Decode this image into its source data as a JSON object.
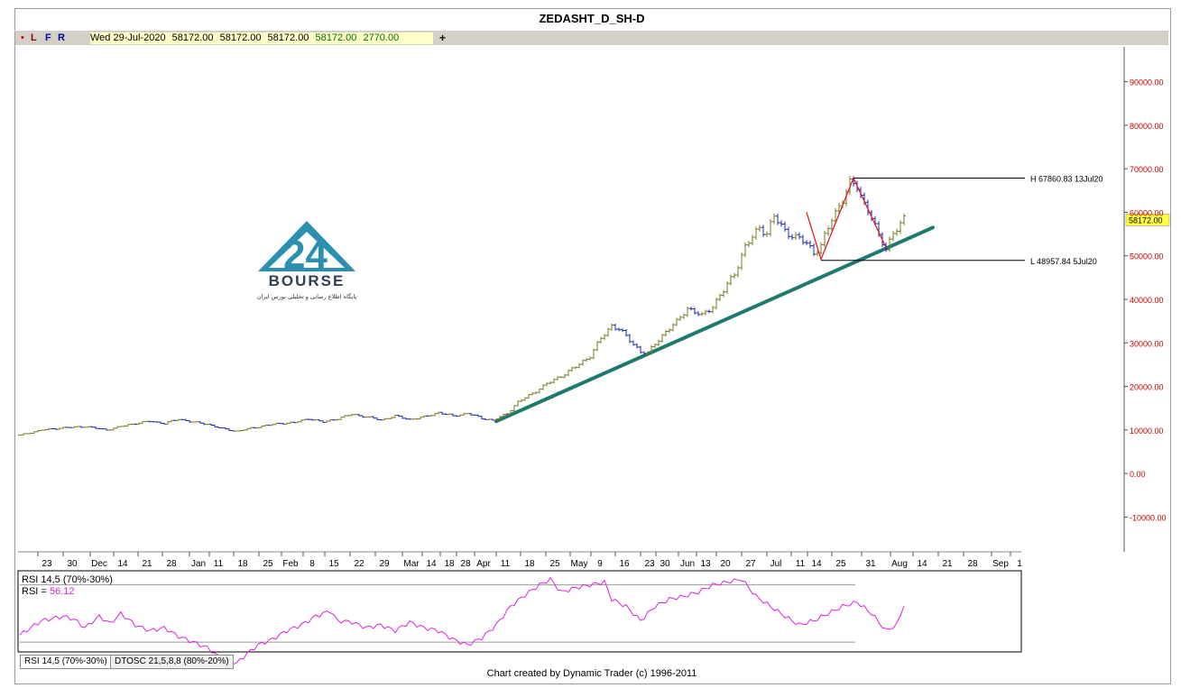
{
  "window": {
    "title": "ZEDASHT_D_SH-D"
  },
  "infobar": {
    "dot": "•",
    "letters": [
      "L",
      "F",
      "R"
    ],
    "date": "Wed 29-Jul-2020",
    "open": "58172.00",
    "high": "58172.00",
    "low": "58172.00",
    "close": "58172.00",
    "volume": "2770.00",
    "plus": "+"
  },
  "logo": {
    "brand": "BOURSE",
    "tagline": "پایگاه اطلاع رسانی و تحلیلی بورس ایران"
  },
  "annotations": {
    "high_label": "H 67860.83 13Jul20",
    "low_label": "L 48957.84 5Jul20",
    "last_price": "58172.00"
  },
  "chart_data": [
    {
      "type": "bar",
      "title": "ZEDASHT_D_SH-D",
      "ylim": [
        -18000,
        98000
      ],
      "yticks": [
        "90000.00",
        "80000.00",
        "70000.00",
        "60000.00",
        "50000.00",
        "40000.00",
        "30000.00",
        "20000.00",
        "10000.00",
        "0.00",
        "-10000.00"
      ],
      "ytick_values": [
        90000,
        80000,
        70000,
        60000,
        50000,
        40000,
        30000,
        20000,
        10000,
        0,
        -10000
      ],
      "xtick_labels": [
        "23",
        "30",
        "Dec",
        "14",
        "21",
        "28",
        "Jan",
        "11",
        "18",
        "25",
        "Feb",
        "8",
        "15",
        "22",
        "29",
        "Mar",
        "14",
        "18",
        "28",
        "Apr",
        "11",
        "18",
        "25",
        "May",
        "9",
        "16",
        "23",
        "30",
        "Jun",
        "13",
        "20",
        "27",
        "Jul",
        "11",
        "14",
        "25",
        "31",
        "Aug",
        "14",
        "21",
        "28",
        "Sep",
        "1"
      ],
      "price_anchors": [
        [
          0,
          8800
        ],
        [
          6,
          10000
        ],
        [
          12,
          10500
        ],
        [
          18,
          10800
        ],
        [
          24,
          10000
        ],
        [
          30,
          11200
        ],
        [
          36,
          12000
        ],
        [
          40,
          11500
        ],
        [
          44,
          12500
        ],
        [
          48,
          11800
        ],
        [
          52,
          11300
        ],
        [
          56,
          10300
        ],
        [
          60,
          9700
        ],
        [
          64,
          10400
        ],
        [
          68,
          11000
        ],
        [
          72,
          11500
        ],
        [
          76,
          11700
        ],
        [
          80,
          12600
        ],
        [
          84,
          11800
        ],
        [
          88,
          12600
        ],
        [
          92,
          13600
        ],
        [
          96,
          13000
        ],
        [
          100,
          12300
        ],
        [
          104,
          13200
        ],
        [
          108,
          12400
        ],
        [
          112,
          13000
        ],
        [
          116,
          14000
        ],
        [
          120,
          13200
        ],
        [
          124,
          13800
        ],
        [
          128,
          12700
        ],
        [
          131,
          12200
        ],
        [
          135,
          13800
        ],
        [
          138,
          16400
        ],
        [
          142,
          18400
        ],
        [
          146,
          20600
        ],
        [
          150,
          22400
        ],
        [
          154,
          24500
        ],
        [
          158,
          27000
        ],
        [
          161,
          31000
        ],
        [
          164,
          34000
        ],
        [
          166,
          33200
        ],
        [
          169,
          30600
        ],
        [
          172,
          28000
        ],
        [
          174,
          27600
        ],
        [
          176,
          29800
        ],
        [
          179,
          32600
        ],
        [
          182,
          34800
        ],
        [
          185,
          38000
        ],
        [
          189,
          36200
        ],
        [
          192,
          38500
        ],
        [
          195,
          42000
        ],
        [
          198,
          46000
        ],
        [
          201,
          52000
        ],
        [
          205,
          56600
        ],
        [
          207,
          55200
        ],
        [
          209,
          59000
        ],
        [
          212,
          55800
        ],
        [
          215,
          54200
        ],
        [
          218,
          53000
        ],
        [
          220,
          50800
        ],
        [
          222,
          52200
        ],
        [
          225,
          58500
        ],
        [
          228,
          63000
        ],
        [
          230,
          66500
        ],
        [
          232,
          66000
        ],
        [
          234,
          62000
        ],
        [
          236,
          59000
        ],
        [
          238,
          54200
        ],
        [
          240,
          51900
        ],
        [
          242,
          55200
        ],
        [
          244,
          57200
        ],
        [
          245,
          58172
        ]
      ],
      "bars_count": 246,
      "trendline": {
        "from": [
          132,
          12000
        ],
        "to": [
          253,
          56500
        ]
      },
      "zigzag": [
        [
          218,
          60000
        ],
        [
          222,
          49200
        ],
        [
          231,
          67860
        ],
        [
          240,
          51900
        ]
      ],
      "high": {
        "value": 67860.83,
        "date": "13Jul20"
      },
      "low": {
        "value": 48957.84,
        "date": "5Jul20"
      },
      "colors": {
        "up": "#7a7a22",
        "down": "#1e2bb0",
        "trend": "#1e7a6e",
        "zigzag": "#e02020"
      }
    },
    {
      "type": "line",
      "title": "RSI 14,5 (70%-30%)",
      "current_label": "RSI =",
      "current": "56.12",
      "ylim": [
        25,
        78
      ],
      "levels": [
        70,
        30
      ],
      "anchors": [
        [
          0,
          35
        ],
        [
          6,
          45
        ],
        [
          12,
          48
        ],
        [
          15,
          46
        ],
        [
          18,
          40
        ],
        [
          22,
          48
        ],
        [
          25,
          43
        ],
        [
          28,
          50
        ],
        [
          32,
          42
        ],
        [
          36,
          38
        ],
        [
          40,
          40
        ],
        [
          44,
          34
        ],
        [
          48,
          30
        ],
        [
          52,
          26
        ],
        [
          56,
          18
        ],
        [
          60,
          15
        ],
        [
          63,
          22
        ],
        [
          66,
          28
        ],
        [
          70,
          32
        ],
        [
          74,
          38
        ],
        [
          78,
          42
        ],
        [
          82,
          48
        ],
        [
          86,
          52
        ],
        [
          88,
          45
        ],
        [
          92,
          44
        ],
        [
          96,
          40
        ],
        [
          100,
          42
        ],
        [
          104,
          38
        ],
        [
          108,
          44
        ],
        [
          112,
          40
        ],
        [
          116,
          38
        ],
        [
          120,
          32
        ],
        [
          124,
          28
        ],
        [
          128,
          33
        ],
        [
          132,
          42
        ],
        [
          136,
          55
        ],
        [
          140,
          63
        ],
        [
          144,
          70
        ],
        [
          147,
          74
        ],
        [
          150,
          65
        ],
        [
          154,
          68
        ],
        [
          158,
          70
        ],
        [
          162,
          72
        ],
        [
          164,
          60
        ],
        [
          168,
          55
        ],
        [
          172,
          45
        ],
        [
          176,
          55
        ],
        [
          180,
          60
        ],
        [
          184,
          62
        ],
        [
          188,
          65
        ],
        [
          192,
          70
        ],
        [
          196,
          72
        ],
        [
          200,
          74
        ],
        [
          204,
          62
        ],
        [
          208,
          55
        ],
        [
          212,
          48
        ],
        [
          216,
          42
        ],
        [
          220,
          45
        ],
        [
          224,
          50
        ],
        [
          228,
          55
        ],
        [
          232,
          58
        ],
        [
          236,
          50
        ],
        [
          240,
          38
        ],
        [
          243,
          42
        ],
        [
          245,
          56.12
        ]
      ],
      "color": "#e020e0"
    }
  ],
  "tabs": [
    "RSI 14,5 (70%-30%)",
    "DTOSC 21,5,8,8 (80%-20%)"
  ],
  "footer": "Chart created by Dynamic Trader  (c) 1996-2011"
}
